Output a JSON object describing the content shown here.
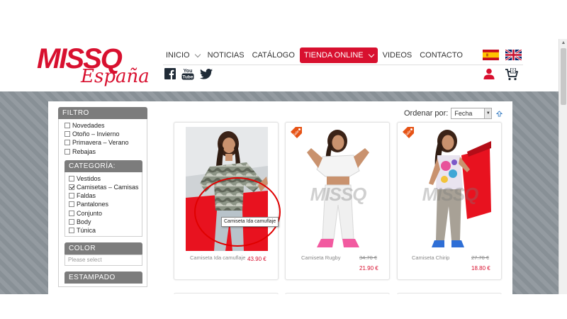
{
  "brand": {
    "logo_word": "MISSQ",
    "logo_sub": "España",
    "color_red": "#d8102f"
  },
  "nav": {
    "items": [
      {
        "label": "INICIO",
        "dropdown": true
      },
      {
        "label": "NOTICIAS"
      },
      {
        "label": "CATÁLOGO"
      },
      {
        "label": "TIENDA ONLINE",
        "dropdown": true,
        "active": true
      },
      {
        "label": "VIDEOS"
      },
      {
        "label": "CONTACTO"
      }
    ]
  },
  "social": {
    "facebook": "facebook-icon",
    "youtube_top": "You",
    "youtube_bottom": "Tube",
    "twitter": "twitter-icon"
  },
  "languages": [
    "Español",
    "English"
  ],
  "cart": {
    "count": "0"
  },
  "filter": {
    "title": "FILTRO",
    "options": [
      {
        "label": "Novedades",
        "checked": false
      },
      {
        "label": "Otoño – Invierno",
        "checked": false
      },
      {
        "label": "Primavera – Verano",
        "checked": false
      },
      {
        "label": "Rebajas",
        "checked": false
      }
    ],
    "categoria": {
      "title": "CATEGORÍA:",
      "options": [
        {
          "label": "Vestidos",
          "checked": false
        },
        {
          "label": "Camisetas – Camisas",
          "checked": true
        },
        {
          "label": "Faldas",
          "checked": false
        },
        {
          "label": "Pantalones",
          "checked": false
        },
        {
          "label": "Conjunto",
          "checked": false
        },
        {
          "label": "Body",
          "checked": false
        },
        {
          "label": "Túnica",
          "checked": false
        }
      ]
    },
    "color": {
      "title": "COLOR",
      "placeholder": "Please select"
    },
    "estampado": {
      "title": "ESTAMPADO"
    }
  },
  "sort": {
    "label": "Ordenar por:",
    "value": "Fecha"
  },
  "products": [
    {
      "name": "Camiseta Ida camuflaje",
      "price": "43.90 €",
      "old_price": "",
      "sale": false
    },
    {
      "name": "Camiseta Rugby",
      "price": "21.90 €",
      "old_price": "34.70 €",
      "sale": true
    },
    {
      "name": "Camiseta Chirip",
      "price": "18.80 €",
      "old_price": "27.70 €",
      "sale": true
    }
  ],
  "sale_label": "Sale",
  "watermark": "MISSQ",
  "tooltip": "Camiseta Ida camuflaje"
}
